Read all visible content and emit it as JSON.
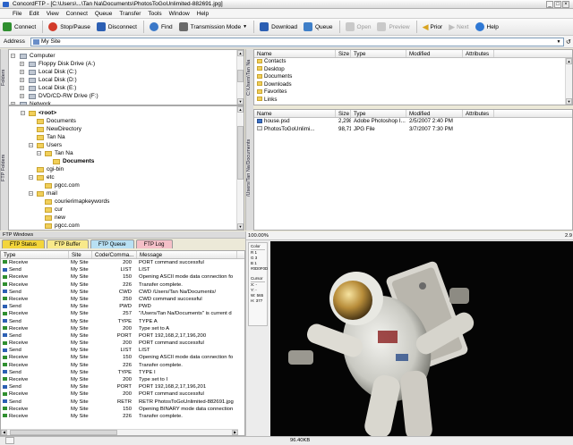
{
  "window": {
    "title": "ConcordFTP - [C:\\Users\\...\\Tan Na\\Documents\\PhotosToGoUnlimited-882691.jpg]",
    "min": "_",
    "max": "□",
    "close": "×"
  },
  "menu": [
    "File",
    "Edit",
    "View",
    "Connect",
    "Queue",
    "Transfer",
    "Tools",
    "Window",
    "Help"
  ],
  "toolbar": {
    "connect": "Connect",
    "stop_pause": "Stop/Pause",
    "disconnect": "Disconnect",
    "find": "Find",
    "transmission_mode": "Transmission Mode",
    "download": "Download",
    "queue": "Queue",
    "open": "Open",
    "preview": "Preview",
    "prior": "Prior",
    "next": "Next",
    "help": "Help",
    "colors": {
      "connect": "#2f8f2f",
      "stop": "#d23a2a",
      "disconnect": "#2c5fb3",
      "find": "#3a78c8",
      "transmission": "#6b6b6b",
      "download": "#2c5fb3",
      "queue": "#3f7fc8",
      "open": "#c9c9c9",
      "preview": "#c9c9c9",
      "prior": "#d9a420",
      "next": "#c9c9c9",
      "help": "#2f78d4"
    }
  },
  "address": {
    "label": "Address",
    "value": "My Site",
    "go_icon": "↺"
  },
  "left_tabs": {
    "folders": "Folders",
    "ftp_folders": "FTP Folders"
  },
  "local_tree": [
    {
      "label": "Computer",
      "level": 0,
      "type": "computer",
      "expander": "−"
    },
    {
      "label": "Floppy Disk Drive (A:)",
      "level": 1,
      "type": "drive",
      "expander": "+"
    },
    {
      "label": "Local Disk (C:)",
      "level": 1,
      "type": "drive",
      "expander": "+"
    },
    {
      "label": "Local Disk (D:)",
      "level": 1,
      "type": "drive",
      "expander": "+"
    },
    {
      "label": "Local Disk (E:)",
      "level": 1,
      "type": "drive",
      "expander": "+"
    },
    {
      "label": "DVD/CD-RW Drive (F:)",
      "level": 1,
      "type": "drive",
      "expander": "+"
    },
    {
      "label": "Network",
      "level": 0,
      "type": "drive",
      "expander": "+"
    }
  ],
  "ftp_tree": [
    {
      "label": "<root>",
      "level": 0,
      "bold": true,
      "expander": "−"
    },
    {
      "label": "Documents",
      "level": 1,
      "bold": false,
      "expander": ""
    },
    {
      "label": "NewDirectory",
      "level": 1,
      "bold": false,
      "expander": ""
    },
    {
      "label": "Tan Na",
      "level": 1,
      "bold": false,
      "expander": ""
    },
    {
      "label": "Users",
      "level": 1,
      "bold": false,
      "expander": "−"
    },
    {
      "label": "Tan Na",
      "level": 2,
      "bold": false,
      "expander": "−"
    },
    {
      "label": "Documents",
      "level": 3,
      "bold": true,
      "expander": ""
    },
    {
      "label": "cgi-bin",
      "level": 1,
      "bold": false,
      "expander": ""
    },
    {
      "label": "etc",
      "level": 1,
      "bold": false,
      "expander": "−"
    },
    {
      "label": "pgcc.com",
      "level": 2,
      "bold": false,
      "expander": ""
    },
    {
      "label": "mail",
      "level": 1,
      "bold": false,
      "expander": "−"
    },
    {
      "label": "courierimapkeywords",
      "level": 2,
      "bold": false,
      "expander": ""
    },
    {
      "label": "cur",
      "level": 2,
      "bold": false,
      "expander": ""
    },
    {
      "label": "new",
      "level": 2,
      "bold": false,
      "expander": ""
    },
    {
      "label": "pgcc.com",
      "level": 2,
      "bold": false,
      "expander": ""
    }
  ],
  "middle_tabs": {
    "top": "C:\\Users\\Tan Na",
    "bottom": "/Users/Tan Na/Documents"
  },
  "columns": {
    "name": "Name",
    "size": "Size",
    "type": "Type",
    "modified": "Modified",
    "attributes": "Attributes"
  },
  "local_files": [
    {
      "name": "Contacts"
    },
    {
      "name": "Desktop"
    },
    {
      "name": "Documents"
    },
    {
      "name": "Downloads"
    },
    {
      "name": "Favorites"
    },
    {
      "name": "Links"
    }
  ],
  "remote_files": [
    {
      "name": "house.psd",
      "size": "2,298,292",
      "type": "Adobe Photoshop I...",
      "modified": "2/5/2007 2:40 PM",
      "icon": "psd"
    },
    {
      "name": "PhotosToGoUnlimi...",
      "size": "98,711",
      "type": "JPG File",
      "modified": "3/7/2007 7:30 PM",
      "icon": "jpg"
    }
  ],
  "ftp_windows": {
    "label": "FTP Windows",
    "tabs": [
      {
        "label": "FTP Status",
        "color": "#f3d53a"
      },
      {
        "label": "FTP Buffer",
        "color": "#f8e98a"
      },
      {
        "label": "FTP Queue",
        "color": "#b8e0f3"
      },
      {
        "label": "FTP Log",
        "color": "#f5c0c8"
      }
    ],
    "columns": {
      "type": "Type",
      "site": "Site",
      "code": "Code/Comma...",
      "message": "Message"
    },
    "log": [
      {
        "type": "Receive",
        "site": "My Site",
        "code": "200",
        "message": "PORT command successful"
      },
      {
        "type": "Send",
        "site": "My Site",
        "code": "LIST",
        "message": "LIST"
      },
      {
        "type": "Receive",
        "site": "My Site",
        "code": "150",
        "message": "Opening ASCII mode data connection fo"
      },
      {
        "type": "Receive",
        "site": "My Site",
        "code": "226",
        "message": "Transfer complete."
      },
      {
        "type": "Send",
        "site": "My Site",
        "code": "CWD",
        "message": "CWD /Users/Tan Na/Documents/"
      },
      {
        "type": "Receive",
        "site": "My Site",
        "code": "250",
        "message": "CWD command successful"
      },
      {
        "type": "Send",
        "site": "My Site",
        "code": "PWD",
        "message": "PWD"
      },
      {
        "type": "Receive",
        "site": "My Site",
        "code": "257",
        "message": "\"/Users/Tan Na/Documents\" is current d"
      },
      {
        "type": "Send",
        "site": "My Site",
        "code": "TYPE",
        "message": "TYPE A"
      },
      {
        "type": "Receive",
        "site": "My Site",
        "code": "200",
        "message": "Type set to A"
      },
      {
        "type": "Send",
        "site": "My Site",
        "code": "PORT",
        "message": "PORT 192,168,2,17,196,200"
      },
      {
        "type": "Receive",
        "site": "My Site",
        "code": "200",
        "message": "PORT command successful"
      },
      {
        "type": "Send",
        "site": "My Site",
        "code": "LIST",
        "message": "LIST"
      },
      {
        "type": "Receive",
        "site": "My Site",
        "code": "150",
        "message": "Opening ASCII mode data connection fo"
      },
      {
        "type": "Receive",
        "site": "My Site",
        "code": "226",
        "message": "Transfer complete."
      },
      {
        "type": "Send",
        "site": "My Site",
        "code": "TYPE",
        "message": "TYPE I"
      },
      {
        "type": "Receive",
        "site": "My Site",
        "code": "200",
        "message": "Type set to I"
      },
      {
        "type": "Send",
        "site": "My Site",
        "code": "PORT",
        "message": "PORT 192,168,2,17,196,201"
      },
      {
        "type": "Receive",
        "site": "My Site",
        "code": "200",
        "message": "PORT command successful"
      },
      {
        "type": "Send",
        "site": "My Site",
        "code": "RETR",
        "message": "RETR PhotosToGoUnlimited-882691.jpg"
      },
      {
        "type": "Receive",
        "site": "My Site",
        "code": "150",
        "message": "Opening BINARY mode data connection"
      },
      {
        "type": "Receive",
        "site": "My Site",
        "code": "226",
        "message": "Transfer complete."
      }
    ]
  },
  "viewer": {
    "zoom": "100.00%",
    "corner": "2.9",
    "color_panel": {
      "title": "Color",
      "r": "1",
      "g": "3",
      "b": "1",
      "hex": "#0D0F0D"
    },
    "cursor_panel": {
      "title": "Cursor",
      "x": "X: -",
      "y": "Y: -",
      "w": "W: 565",
      "h": "H: 377"
    }
  },
  "status": {
    "size": "96.40KB"
  }
}
